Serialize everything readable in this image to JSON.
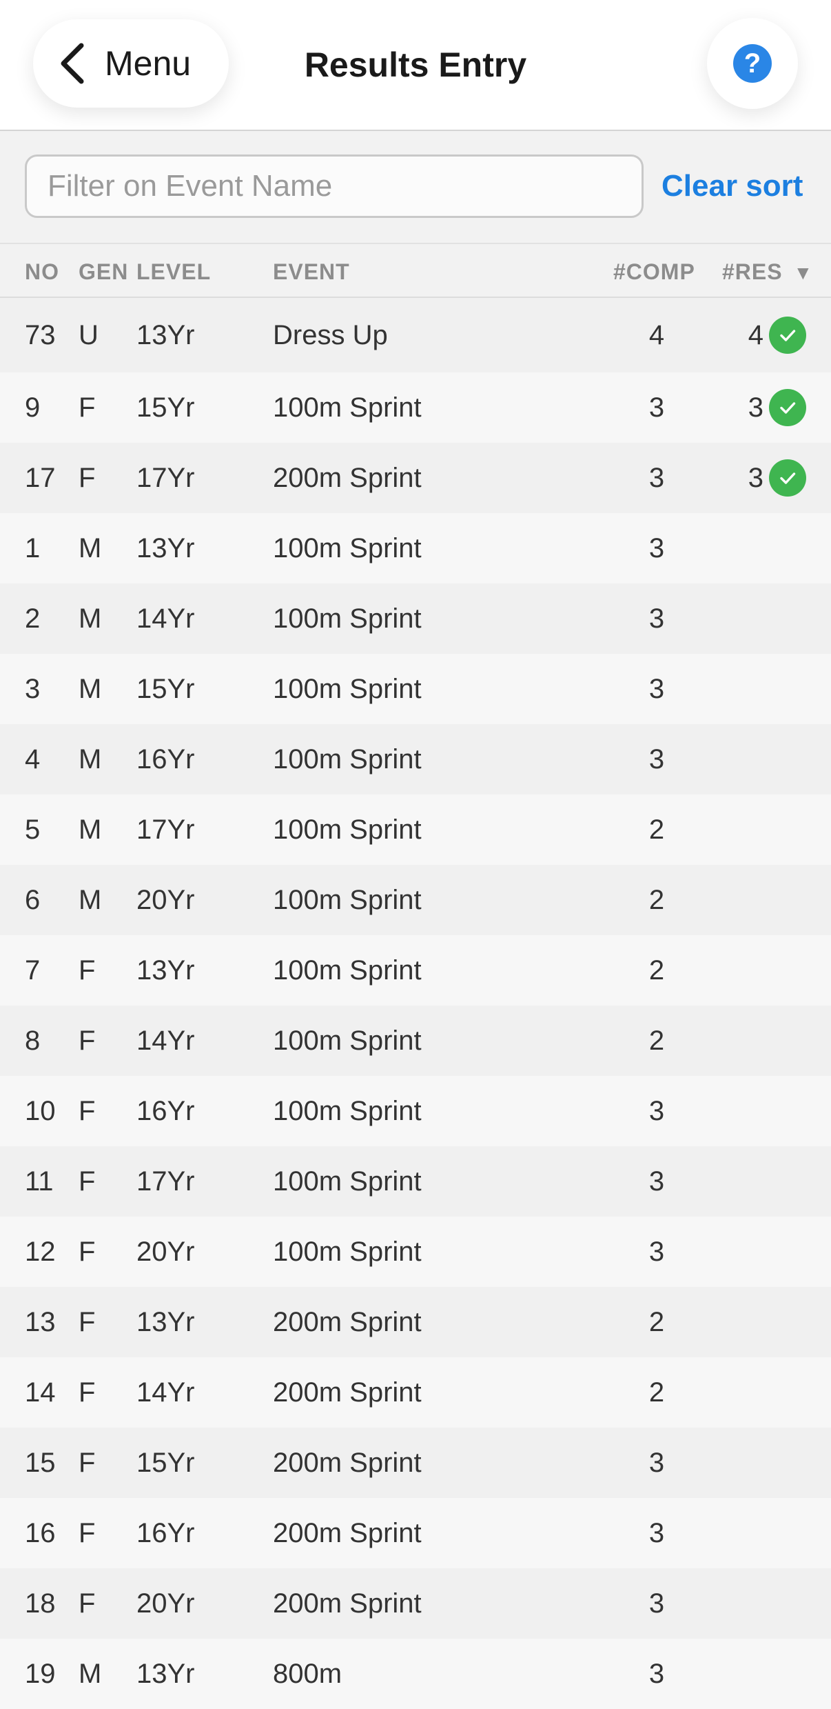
{
  "header": {
    "back_label": "Menu",
    "title": "Results Entry",
    "help_glyph": "?"
  },
  "filter": {
    "placeholder": "Filter on Event Name",
    "value": "",
    "clear_sort_label": "Clear sort"
  },
  "columns": {
    "no": "NO",
    "gen": "GEN",
    "level": "LEVEL",
    "event": "EVENT",
    "comp": "#COMP",
    "res": "#RES",
    "sort_indicator": "▼"
  },
  "colors": {
    "accent": "#1c7fe0",
    "help": "#2a86e6",
    "complete": "#3fb550"
  },
  "rows": [
    {
      "no": "73",
      "gen": "U",
      "level": "13Yr",
      "event": "Dress Up",
      "comp": "4",
      "res": "4",
      "complete": true
    },
    {
      "no": "9",
      "gen": "F",
      "level": "15Yr",
      "event": "100m Sprint",
      "comp": "3",
      "res": "3",
      "complete": true
    },
    {
      "no": "17",
      "gen": "F",
      "level": "17Yr",
      "event": "200m Sprint",
      "comp": "3",
      "res": "3",
      "complete": true
    },
    {
      "no": "1",
      "gen": "M",
      "level": "13Yr",
      "event": "100m Sprint",
      "comp": "3",
      "res": "",
      "complete": false
    },
    {
      "no": "2",
      "gen": "M",
      "level": "14Yr",
      "event": "100m Sprint",
      "comp": "3",
      "res": "",
      "complete": false
    },
    {
      "no": "3",
      "gen": "M",
      "level": "15Yr",
      "event": "100m Sprint",
      "comp": "3",
      "res": "",
      "complete": false
    },
    {
      "no": "4",
      "gen": "M",
      "level": "16Yr",
      "event": "100m Sprint",
      "comp": "3",
      "res": "",
      "complete": false
    },
    {
      "no": "5",
      "gen": "M",
      "level": "17Yr",
      "event": "100m Sprint",
      "comp": "2",
      "res": "",
      "complete": false
    },
    {
      "no": "6",
      "gen": "M",
      "level": "20Yr",
      "event": "100m Sprint",
      "comp": "2",
      "res": "",
      "complete": false
    },
    {
      "no": "7",
      "gen": "F",
      "level": "13Yr",
      "event": "100m Sprint",
      "comp": "2",
      "res": "",
      "complete": false
    },
    {
      "no": "8",
      "gen": "F",
      "level": "14Yr",
      "event": "100m Sprint",
      "comp": "2",
      "res": "",
      "complete": false
    },
    {
      "no": "10",
      "gen": "F",
      "level": "16Yr",
      "event": "100m Sprint",
      "comp": "3",
      "res": "",
      "complete": false
    },
    {
      "no": "11",
      "gen": "F",
      "level": "17Yr",
      "event": "100m Sprint",
      "comp": "3",
      "res": "",
      "complete": false
    },
    {
      "no": "12",
      "gen": "F",
      "level": "20Yr",
      "event": "100m Sprint",
      "comp": "3",
      "res": "",
      "complete": false
    },
    {
      "no": "13",
      "gen": "F",
      "level": "13Yr",
      "event": "200m Sprint",
      "comp": "2",
      "res": "",
      "complete": false
    },
    {
      "no": "14",
      "gen": "F",
      "level": "14Yr",
      "event": "200m Sprint",
      "comp": "2",
      "res": "",
      "complete": false
    },
    {
      "no": "15",
      "gen": "F",
      "level": "15Yr",
      "event": "200m Sprint",
      "comp": "3",
      "res": "",
      "complete": false
    },
    {
      "no": "16",
      "gen": "F",
      "level": "16Yr",
      "event": "200m Sprint",
      "comp": "3",
      "res": "",
      "complete": false
    },
    {
      "no": "18",
      "gen": "F",
      "level": "20Yr",
      "event": "200m Sprint",
      "comp": "3",
      "res": "",
      "complete": false
    },
    {
      "no": "19",
      "gen": "M",
      "level": "13Yr",
      "event": "800m",
      "comp": "3",
      "res": "",
      "complete": false
    }
  ]
}
